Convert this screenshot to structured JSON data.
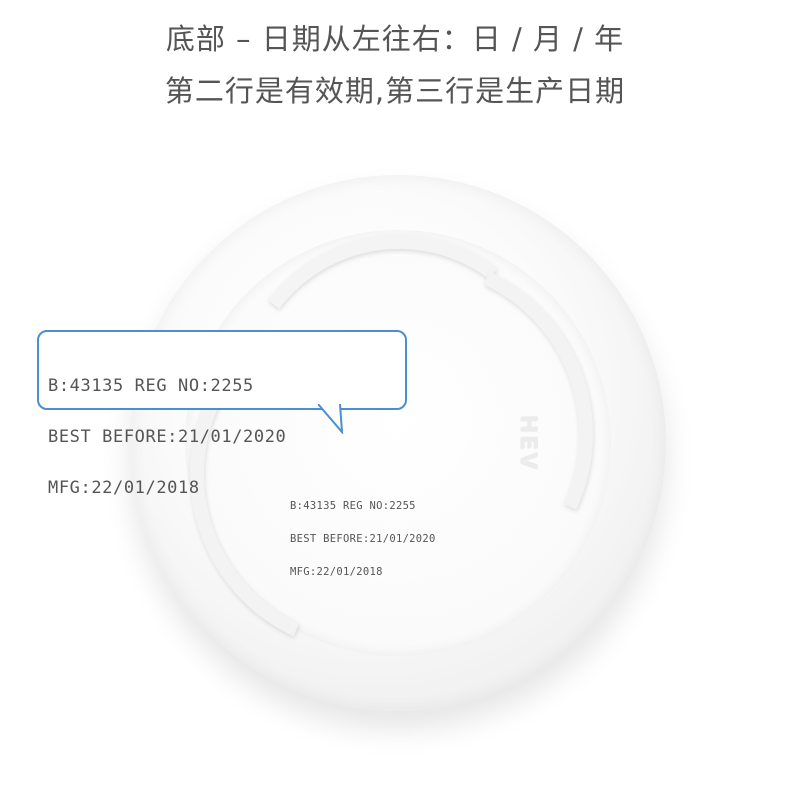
{
  "caption": {
    "line1": "底部 – 日期从左往右：日 / 月 / 年",
    "line2": "第二行是有效期,第三行是生产日期"
  },
  "lid_print": {
    "line1": "B:43135 REG NO:2255",
    "line2": "BEST BEFORE:21/01/2020",
    "line3": "MFG:22/01/2018"
  },
  "callout": {
    "line1": "B:43135 REG NO:2255",
    "line2": "BEST BEFORE:21/01/2020",
    "line3": "MFG:22/01/2018"
  },
  "emboss_text": "HEV",
  "colors": {
    "callout_border": "#4a90d0",
    "caption_text": "#555555"
  }
}
